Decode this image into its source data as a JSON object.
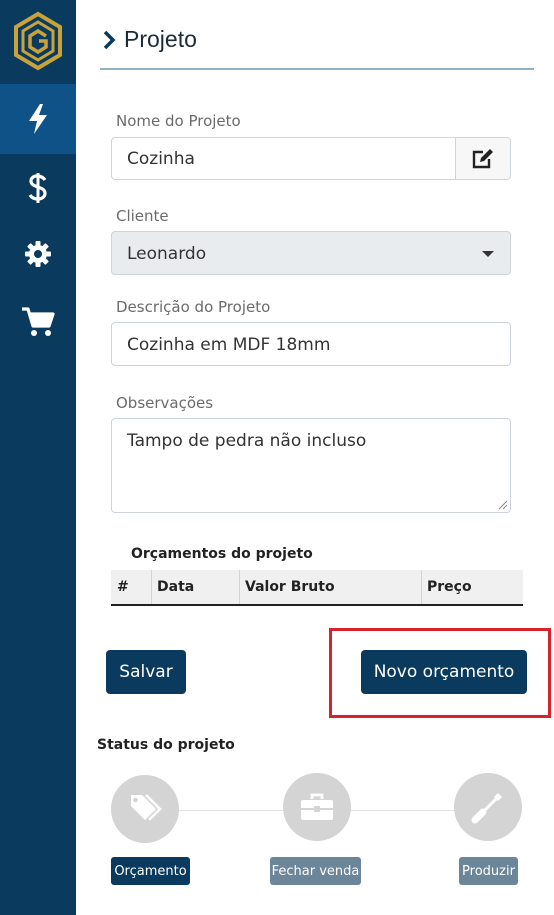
{
  "sidebar": {
    "items": [
      {
        "icon": "lightning-icon",
        "active": true
      },
      {
        "icon": "dollar-icon",
        "active": false
      },
      {
        "icon": "gear-icon",
        "active": false
      },
      {
        "icon": "cart-icon",
        "active": false
      }
    ]
  },
  "header": {
    "title": "Projeto"
  },
  "form": {
    "project_name": {
      "label": "Nome do Projeto",
      "value": "Cozinha"
    },
    "client": {
      "label": "Cliente",
      "value": "Leonardo"
    },
    "description": {
      "label": "Descrição do Projeto",
      "value": "Cozinha em MDF 18mm"
    },
    "notes": {
      "label": "Observações",
      "value": "Tampo de pedra não incluso"
    }
  },
  "budgets": {
    "title": "Orçamentos do projeto",
    "columns": [
      "#",
      "Data",
      "Valor Bruto",
      "Preço"
    ],
    "rows": []
  },
  "actions": {
    "save_label": "Salvar",
    "new_budget_label": "Novo orçamento"
  },
  "status": {
    "title": "Status do projeto",
    "steps": [
      {
        "label": "Orçamento",
        "icon": "tags-icon",
        "active": true
      },
      {
        "label": "Fechar venda",
        "icon": "toolbox-icon",
        "active": false
      },
      {
        "label": "Produzir",
        "icon": "screwdriver-icon",
        "active": false
      }
    ]
  },
  "colors": {
    "primary": "#0a3a5e",
    "sidebar_active": "#0f5288",
    "highlight": "#d7222b",
    "inactive_step": "#6b8699"
  }
}
